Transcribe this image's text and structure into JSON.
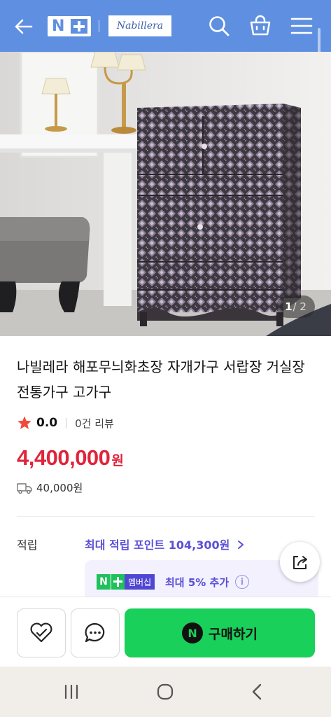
{
  "header": {
    "brand_logo_text": "Nabillera",
    "icons": [
      "back-arrow-icon",
      "naver-plus-logo",
      "search-icon",
      "cart-icon",
      "menu-icon"
    ]
  },
  "gallery": {
    "current": "1",
    "total": "/ 2"
  },
  "product": {
    "title": "나빌레라 해포무늬화초장 자개가구 서랍장 거실장 전통가구 고가구",
    "rating": "0.0",
    "review_count": "0건 리뷰",
    "price": "4,400,000",
    "currency": "원",
    "shipping_fee": "40,000원"
  },
  "points": {
    "label": "적립",
    "max_points_text": "최대 적립 포인트 104,300원",
    "member_badge_n": "N",
    "member_badge_text": "멤버십",
    "member_rate_text": "최대 5% 추가",
    "info": "i"
  },
  "actions": {
    "buy_logo": "N",
    "buy_label": "구매하기"
  },
  "colors": {
    "header_bg": "#5f8fe0",
    "price": "#e0243b",
    "points_accent": "#5a4fd6",
    "buy_button": "#19d05a"
  }
}
